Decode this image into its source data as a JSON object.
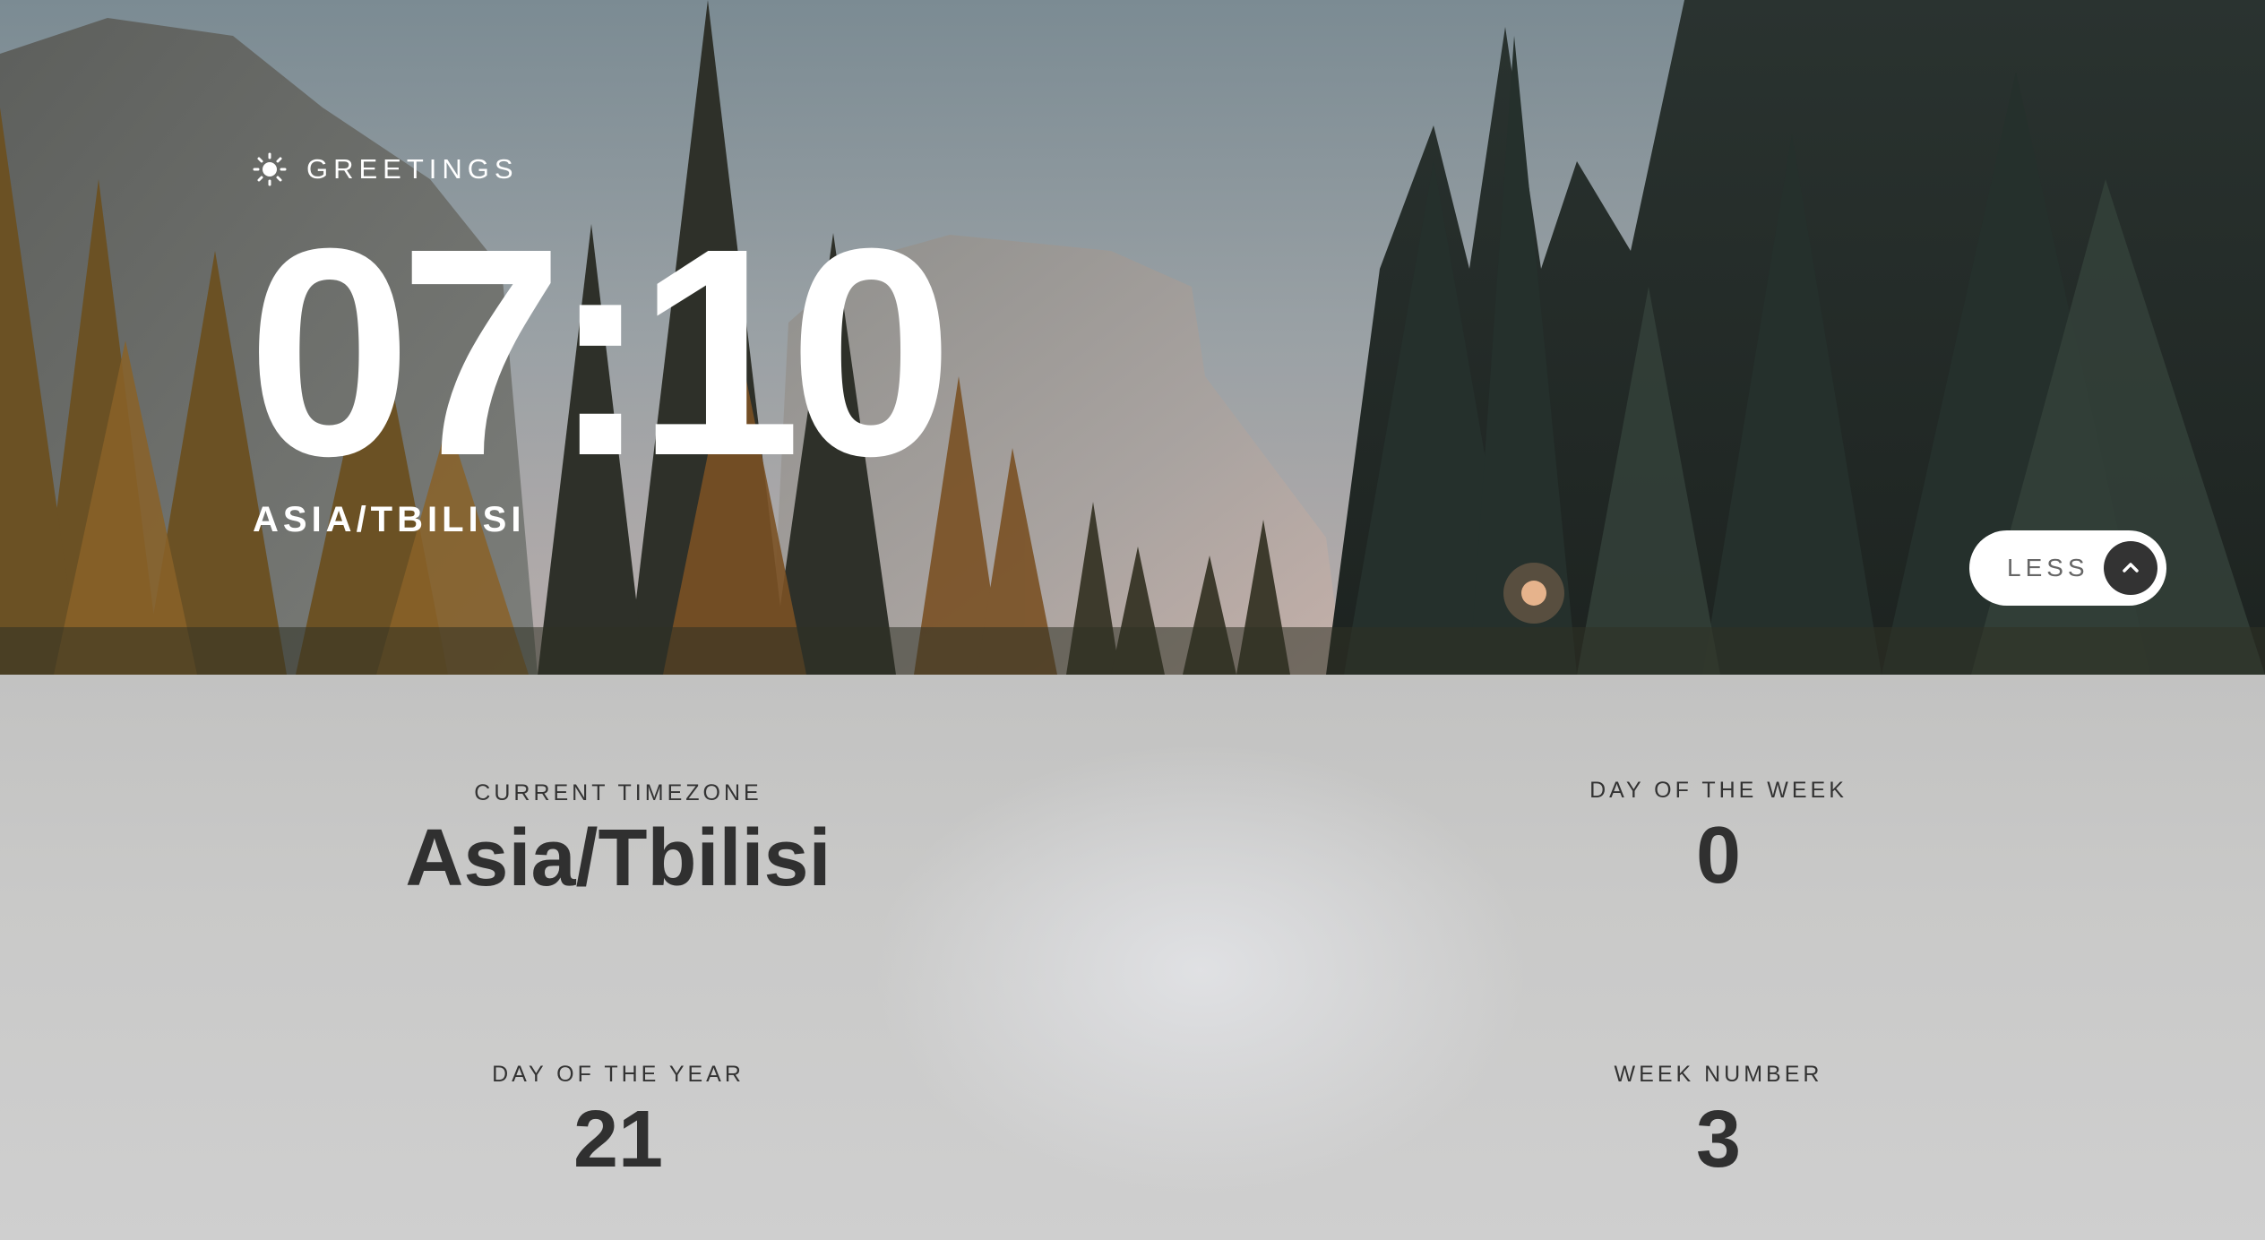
{
  "hero": {
    "greeting_icon": "sun-icon",
    "greeting": "GREETINGS",
    "time": "07:10",
    "location": "ASIA/TBILISI",
    "less_button_label": "LESS",
    "less_button_icon": "chevron-up-icon"
  },
  "details": {
    "timezone_label": "CURRENT TIMEZONE",
    "timezone_value": "Asia/Tbilisi",
    "day_of_week_label": "DAY OF THE WEEK",
    "day_of_week_value": "0",
    "day_of_year_label": "DAY OF THE YEAR",
    "day_of_year_value": "21",
    "week_number_label": "WEEK NUMBER",
    "week_number_value": "3"
  },
  "colors": {
    "text_light": "#ffffff",
    "text_dark": "#303030",
    "panel_bg": "#c8c8c7",
    "button_bg": "#ffffff",
    "button_icon_bg": "#333333"
  }
}
